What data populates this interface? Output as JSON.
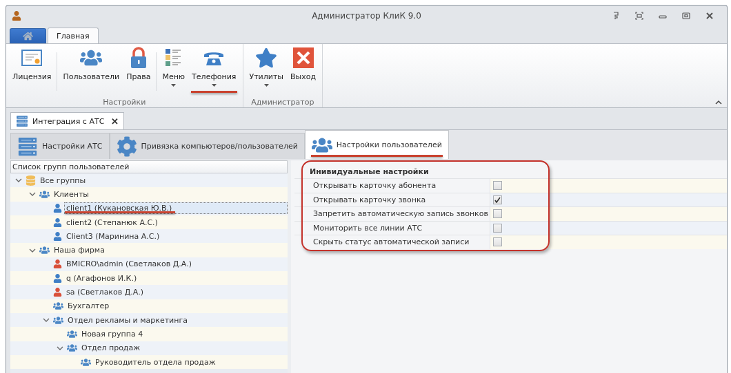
{
  "window": {
    "title": "Администратор КлиК 9.0"
  },
  "ribbon_tabs": [
    {
      "kind": "home",
      "selected": false
    },
    {
      "kind": "text",
      "label": "Главная",
      "selected": true
    }
  ],
  "ribbon_groups": [
    {
      "label": "Настройки",
      "sections": [
        [
          {
            "label": "Лицензия",
            "kind": "license",
            "dropdown": false,
            "underlined": false
          }
        ],
        [
          {
            "label": "Пользователи",
            "kind": "users",
            "dropdown": false,
            "underlined": false
          },
          {
            "label": "Права",
            "kind": "lock",
            "dropdown": false,
            "underlined": false
          }
        ],
        [
          {
            "label": "Меню",
            "kind": "menu",
            "dropdown": true,
            "underlined": false
          },
          {
            "label": "Телефония",
            "kind": "phone",
            "dropdown": true,
            "underlined": true
          }
        ]
      ]
    },
    {
      "label": "Администратор",
      "sections": [
        [
          {
            "label": "Утилиты",
            "kind": "star",
            "dropdown": true,
            "underlined": false
          },
          {
            "label": "Выход",
            "kind": "exit",
            "dropdown": false,
            "underlined": false
          }
        ]
      ]
    }
  ],
  "document_tab": {
    "label": "Интеграция с АТС",
    "close": "✕"
  },
  "tabs": [
    {
      "label": "Настройки АТС",
      "kind": "server",
      "selected": false,
      "underlined": false
    },
    {
      "label": "Привязка компьютеров/пользователей",
      "kind": "gear",
      "selected": false,
      "underlined": false
    },
    {
      "label": "Настройки пользователей",
      "kind": "users",
      "selected": true,
      "underlined": true
    }
  ],
  "tree": {
    "title": "Список групп пользователей",
    "items": [
      {
        "label": "Все группы",
        "kind": "database",
        "expanded": true,
        "selected": false,
        "underlined": false,
        "children": [
          {
            "label": "Клиенты",
            "kind": "group",
            "expanded": true,
            "selected": false,
            "underlined": false,
            "children": [
              {
                "label": "client1 (Кукановская Ю.В.)",
                "kind": "user",
                "selected": true,
                "underlined": true
              },
              {
                "label": "client2 (Степанюк А.С.)",
                "kind": "user",
                "selected": false,
                "underlined": false
              },
              {
                "label": "Client3 (Маринина А.С.)",
                "kind": "user",
                "selected": false,
                "underlined": false
              }
            ]
          },
          {
            "label": "Наша фирма",
            "kind": "group",
            "expanded": true,
            "selected": false,
            "underlined": false,
            "children": [
              {
                "label": "BMICRO\\admin (Светлаков Д.А.)",
                "kind": "admin",
                "selected": false,
                "underlined": false
              },
              {
                "label": "q (Агафонов И.К.)",
                "kind": "user",
                "selected": false,
                "underlined": false
              },
              {
                "label": "sa (Светлаков Д.А.)",
                "kind": "admin",
                "selected": false,
                "underlined": false
              },
              {
                "label": "Бухгалтер",
                "kind": "group",
                "selected": false,
                "underlined": false
              },
              {
                "label": "Отдел рекламы и маркетинга",
                "kind": "group",
                "expanded": true,
                "selected": false,
                "underlined": false,
                "children": [
                  {
                    "label": "Новая группа 4",
                    "kind": "group",
                    "selected": false,
                    "underlined": false
                  },
                  {
                    "label": "Отдел продаж",
                    "kind": "group",
                    "expanded": true,
                    "selected": false,
                    "underlined": false,
                    "children": [
                      {
                        "label": "Руководитель отдела продаж",
                        "kind": "group",
                        "selected": false,
                        "underlined": false
                      }
                    ]
                  }
                ]
              }
            ]
          }
        ]
      }
    ]
  },
  "settings": {
    "title": "Инивидуальные настройки",
    "outlined": true,
    "rows": [
      {
        "label": "Открывать карточку абонента",
        "checked": false
      },
      {
        "label": "Открывать карточку звонка",
        "checked": true
      },
      {
        "label": "Запретить автоматическую запись звонков",
        "checked": false
      },
      {
        "label": "Мониторить все линии АТС",
        "checked": false
      },
      {
        "label": "Скрыть статус автоматической записи",
        "checked": false
      }
    ]
  }
}
